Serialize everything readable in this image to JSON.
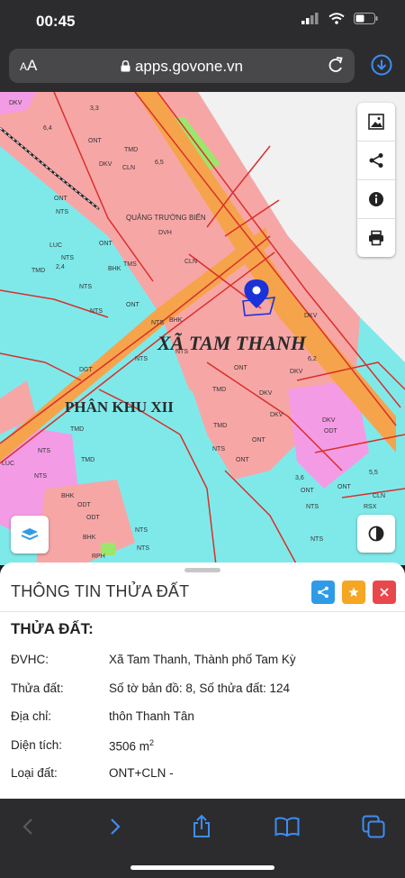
{
  "status": {
    "time": "00:45"
  },
  "browser": {
    "aa_small": "A",
    "aa_large": "A",
    "url": "apps.govone.vn"
  },
  "map": {
    "place_label": "XÃ TAM THANH",
    "zone_label": "PHÂN KHU XII",
    "road_label": "QUẢNG TRƯỜNG BIỂN",
    "codes": {
      "dkv": "DKV",
      "ont": "ONT",
      "nts": "NTS",
      "tmd": "TMD",
      "cln": "CLN",
      "luc": "LUC",
      "bhk": "BHK",
      "dgt": "DGT",
      "odt": "ODT",
      "rsx": "RSX",
      "rph": "RPH",
      "dvh": "DVH",
      "tms": "TMS"
    },
    "numbers": {
      "n64": "6,4",
      "n33": "3,3",
      "n65": "6,5",
      "n24": "2,4",
      "n62": "6,2",
      "n36": "3,6",
      "n55": "5,5"
    }
  },
  "panel": {
    "title": "THÔNG TIN THỬA ĐẤT",
    "section_title": "THỬA ĐẤT:",
    "rows": [
      {
        "label": "ĐVHC:",
        "value": "Xã Tam Thanh, Thành phố Tam Kỳ"
      },
      {
        "label": "Thửa đất:",
        "value": "Số tờ bản đồ: 8, Số thửa đất: 124"
      },
      {
        "label": "Địa chỉ:",
        "value": "thôn Thanh Tân"
      },
      {
        "label": "Diện tích:",
        "value": "3506 m",
        "unit_sup": "2"
      },
      {
        "label": "Loại đất:",
        "value": "ONT+CLN -"
      }
    ]
  },
  "colors": {
    "pink": "#f7a6a6",
    "magenta": "#f49be6",
    "cyan": "#7fe9ea",
    "orange": "#f6a44c",
    "road_red": "#d9302a",
    "pin": "#1b31d9",
    "green": "#9be66b"
  }
}
